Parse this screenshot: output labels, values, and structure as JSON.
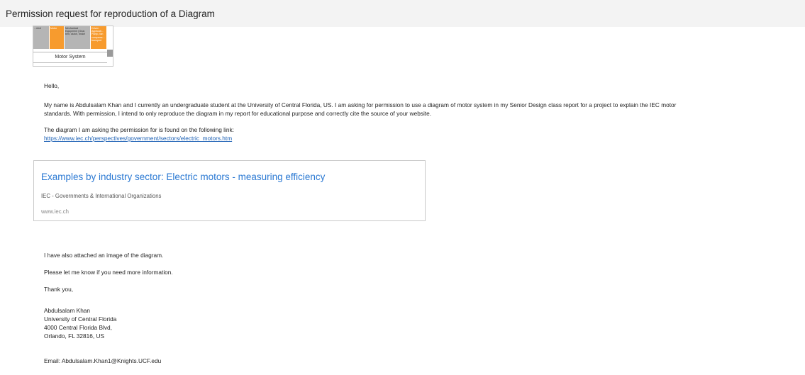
{
  "header": {
    "subject": "Permission request for reproduction of a Diagram"
  },
  "thumbnail": {
    "cells": [
      "...ntrol",
      "Motor",
      "Mechanical Equipment (Gear, belt, clutch, brake",
      "Driven Applicati... Pump, fan compress... transport"
    ],
    "caption": "Motor System"
  },
  "body": {
    "greeting": "Hello,",
    "para1_line1": "My name  is Abdulsalam Khan and I currently an undergraduate student at the University of Central Florida, US. I am asking for permission to use a diagram of motor system in my Senior Design class report for a project to explain the IEC motor",
    "para1_line2": "standards. With permission, I intend to only reproduce the diagram in my report for educational purpose and correctly cite the source of your website.",
    "para2": "The diagram I am asking the permission for is found on the following link:",
    "link": "https://www.iec.ch/perspectives/government/sectors/electric_motors.htm",
    "attached": "I have also attached an image of the diagram.",
    "more_info": "Please let me know if you need more information.",
    "thanks": "Thank you,"
  },
  "link_preview": {
    "title": "Examples by industry sector: Electric motors - measuring efficiency",
    "site": "IEC - Governments & International Organizations",
    "domain": "www.iec.ch"
  },
  "signature": {
    "name": "Abdulsalam Khan",
    "org": "University of Central Florida",
    "street": "4000 Central Florida Blvd,",
    "city": "Orlando, FL 32816, US",
    "email": "Email: Abdulsalam.Khan1@Knights.UCF.edu"
  }
}
